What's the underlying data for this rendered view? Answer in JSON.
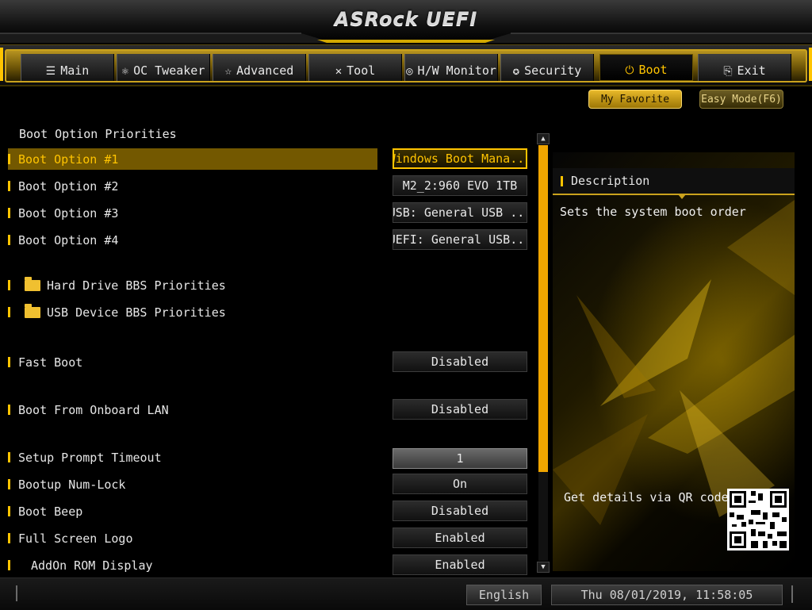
{
  "header": {
    "brand": "ASRock UEFI"
  },
  "tabs": [
    {
      "label": "Main",
      "icon": "list-icon",
      "glyph": "☰"
    },
    {
      "label": "OC Tweaker",
      "icon": "rocket-icon",
      "glyph": "⚛"
    },
    {
      "label": "Advanced",
      "icon": "star-icon",
      "glyph": "☆"
    },
    {
      "label": "Tool",
      "icon": "wrench-icon",
      "glyph": "✕"
    },
    {
      "label": "H/W Monitor",
      "icon": "monitor-icon",
      "glyph": "◎"
    },
    {
      "label": "Security",
      "icon": "shield-icon",
      "glyph": "✪"
    },
    {
      "label": "Boot",
      "icon": "power-icon",
      "glyph": "⏻",
      "active": true
    },
    {
      "label": "Exit",
      "icon": "exit-icon",
      "glyph": "⎘"
    }
  ],
  "top_buttons": {
    "favorite": "My Favorite",
    "easy_mode": "Easy Mode(F6)"
  },
  "section_title": "Boot Option Priorities",
  "settings": {
    "boot1": {
      "label": "Boot Option #1",
      "value": "Windows Boot Mana..."
    },
    "boot2": {
      "label": "Boot Option #2",
      "value": "M2_2:960 EVO 1TB"
    },
    "boot3": {
      "label": "Boot Option #3",
      "value": "USB: General USB ..."
    },
    "boot4": {
      "label": "Boot Option #4",
      "value": "UEFI: General USB..."
    },
    "hdd_bbs": {
      "label": "Hard Drive BBS Priorities"
    },
    "usb_bbs": {
      "label": "USB Device BBS Priorities"
    },
    "fast_boot": {
      "label": "Fast Boot",
      "value": "Disabled"
    },
    "onboard_lan": {
      "label": "Boot From Onboard LAN",
      "value": "Disabled"
    },
    "setup_timeout": {
      "label": "Setup Prompt Timeout",
      "value": "1"
    },
    "numlock": {
      "label": "Bootup Num-Lock",
      "value": "On"
    },
    "boot_beep": {
      "label": "Boot Beep",
      "value": "Disabled"
    },
    "fullscreen_logo": {
      "label": "Full Screen Logo",
      "value": "Enabled"
    },
    "addon_rom": {
      "label": "AddOn ROM Display",
      "value": "Enabled"
    }
  },
  "description": {
    "title": "Description",
    "text": "Sets the system boot order",
    "qr_text": "Get details via QR code"
  },
  "footer": {
    "language": "English",
    "datetime": "Thu 08/01/2019, 11:58:05"
  },
  "colors": {
    "accent": "#ffc400",
    "selected_row": "#735800"
  }
}
